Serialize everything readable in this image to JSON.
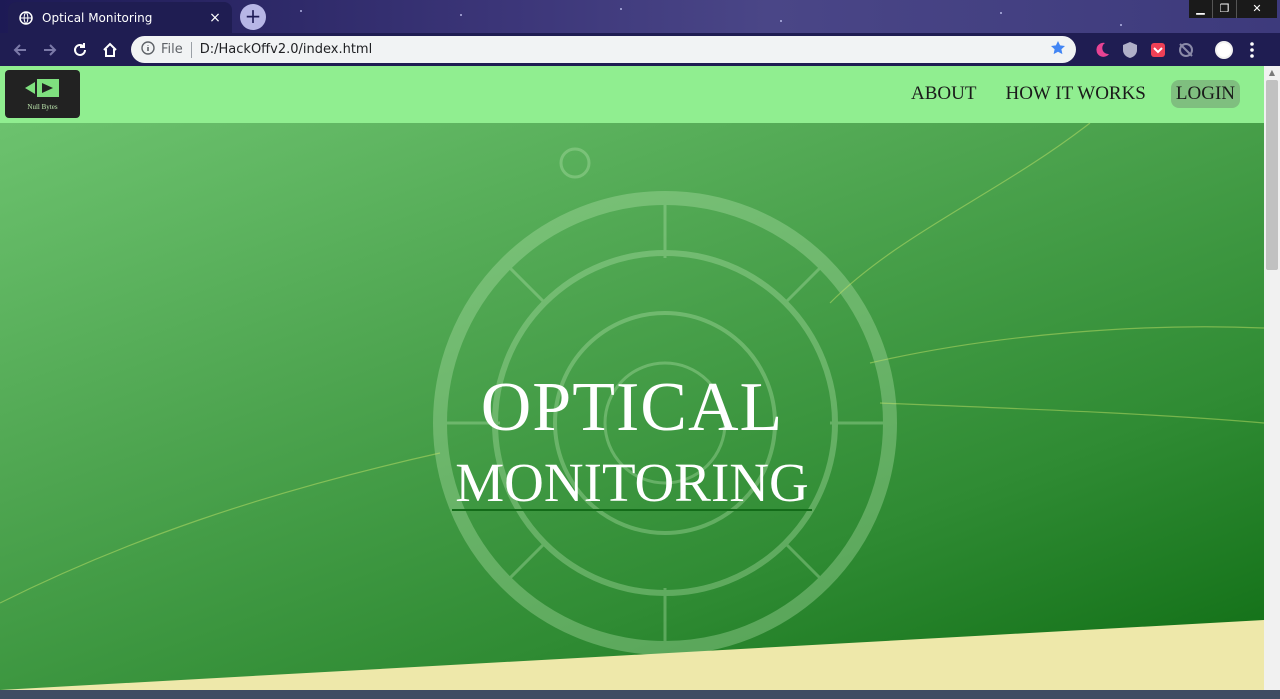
{
  "browser": {
    "tab_title": "Optical Monitoring",
    "tab_close": "×",
    "new_tab": "+",
    "window_controls": {
      "minimize": "▁",
      "maximize": "❐",
      "close": "✕"
    },
    "address": {
      "scheme_label": "File",
      "url": "D:/HackOffv2.0/index.html"
    },
    "icons": [
      "back-arrow-icon",
      "forward-arrow-icon",
      "reload-icon",
      "home-icon",
      "info-icon",
      "bookmark-star-icon",
      "dark-mode-extension-icon",
      "extension-icon",
      "pocket-extension-icon",
      "sync-icon",
      "profile-avatar-icon",
      "menu-dots-icon"
    ]
  },
  "navbar": {
    "logo_text": "Null Bytes",
    "links": {
      "about": "ABOUT",
      "how_it_works": "HOW IT WORKS",
      "login": "LOGIN"
    }
  },
  "hero": {
    "title_line1": "OPTICAL",
    "title_line2": "MONITORING"
  },
  "colors": {
    "navbar_bg": "#90ee90",
    "hero_gradient_start": "#6cc26e",
    "hero_gradient_end": "#0d6b12",
    "cream_band": "#eee8aa",
    "login_button_bg": "#7fbf7f"
  }
}
